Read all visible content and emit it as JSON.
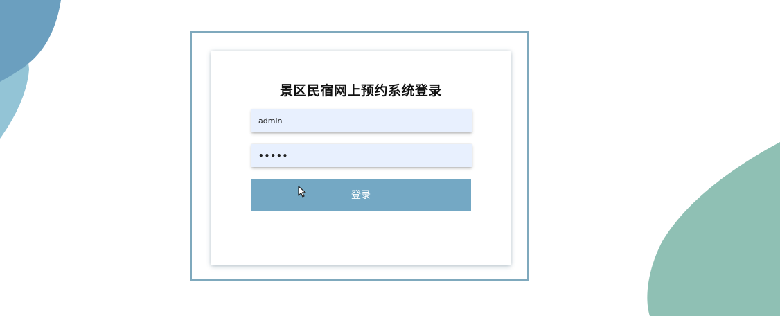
{
  "login": {
    "title": "景区民宿网上预约系统登录",
    "username_value": "admin",
    "password_value": "•••••",
    "submit_label": "登录"
  },
  "colors": {
    "blob_top_left_dark": "#6b9fbf",
    "blob_top_left_light": "#93c4d6",
    "blob_bottom_right": "#8fc0b4",
    "frame_border": "#7fa9bd",
    "button_bg": "#74a8c4",
    "input_bg": "#e8f0fe"
  },
  "icons": {
    "cursor": "mouse-pointer-icon"
  }
}
